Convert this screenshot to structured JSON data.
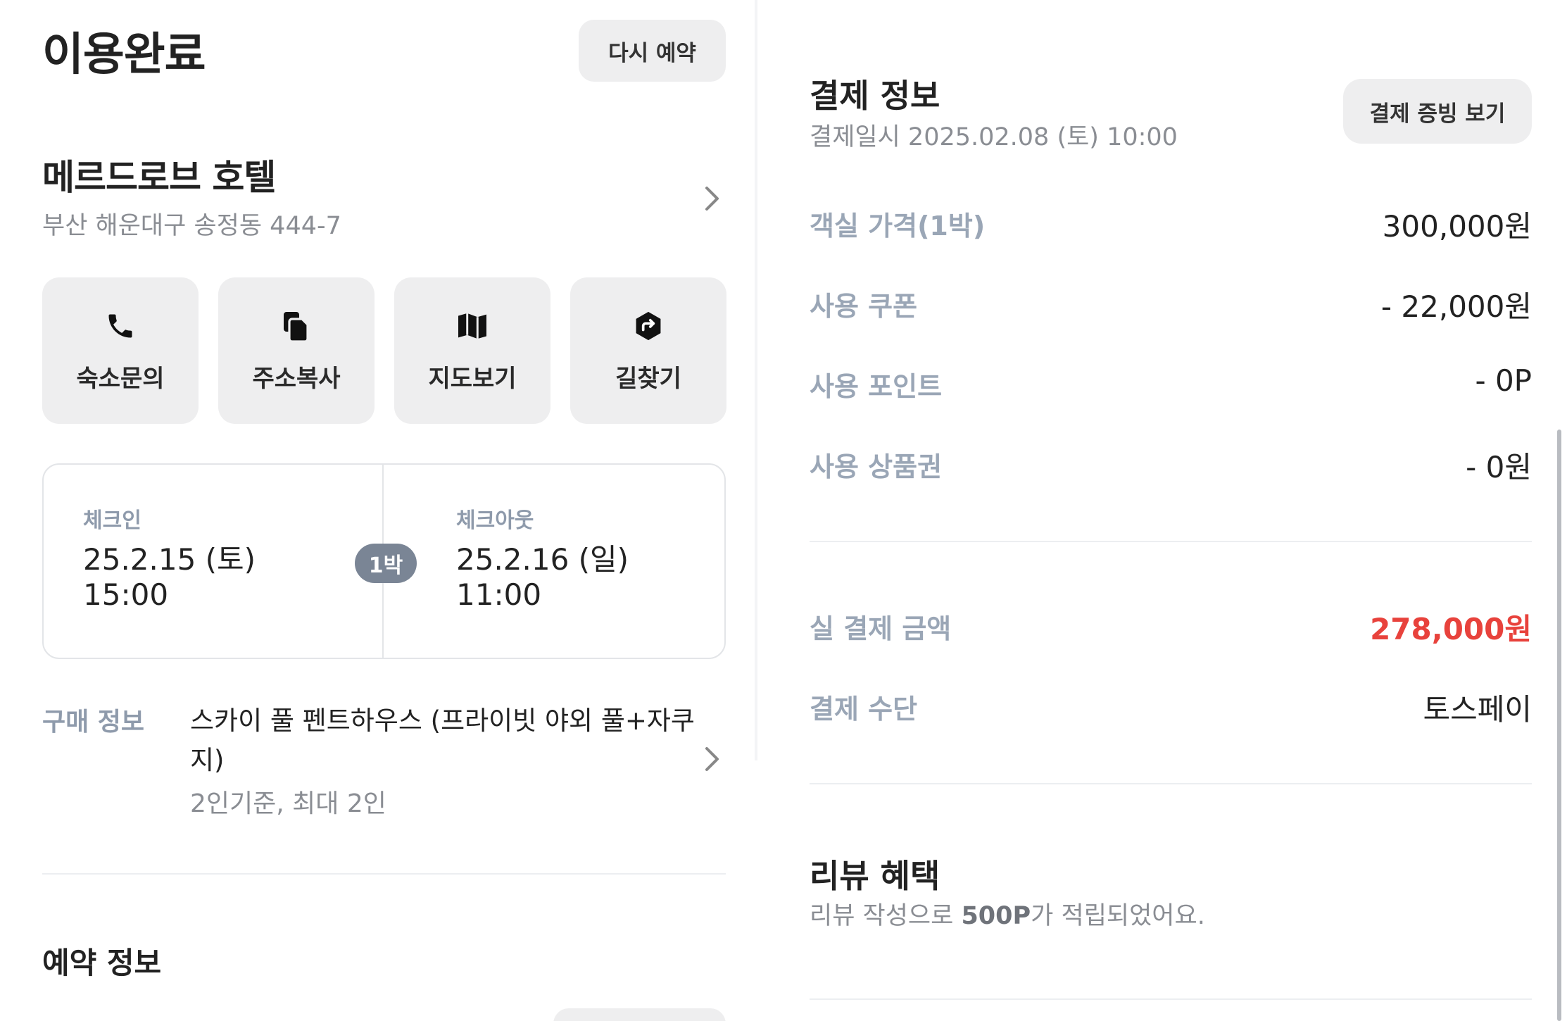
{
  "status": {
    "title": "이용완료",
    "rebook_label": "다시 예약"
  },
  "hotel": {
    "name": "메르드로브 호텔",
    "address": "부산 해운대구 송정동 444-7"
  },
  "actions": [
    {
      "label": "숙소문의",
      "icon": "phone-icon"
    },
    {
      "label": "주소복사",
      "icon": "copy-icon"
    },
    {
      "label": "지도보기",
      "icon": "map-icon"
    },
    {
      "label": "길찾기",
      "icon": "directions-icon"
    }
  ],
  "stay": {
    "checkin_label": "체크인",
    "checkin_date": "25.2.15 (토)",
    "checkin_time": "15:00",
    "nights": "1박",
    "checkout_label": "체크아웃",
    "checkout_date": "25.2.16 (일)",
    "checkout_time": "11:00"
  },
  "purchase": {
    "label": "구매 정보",
    "product": "스카이 풀 펜트하우스 (프라이빗 야외 풀+자쿠지)",
    "capacity": "2인기준, 최대 2인"
  },
  "reservation": {
    "title": "예약 정보"
  },
  "payment": {
    "title": "결제 정보",
    "date": "결제일시 2025.02.08 (토) 10:00",
    "receipt_label": "결제 증빙 보기",
    "rows": [
      {
        "label": "객실 가격(1박)",
        "value": "300,000원"
      },
      {
        "label": "사용 쿠폰",
        "value": "- 22,000원"
      },
      {
        "label": "사용 포인트",
        "value": "- 0P"
      },
      {
        "label": "사용 상품권",
        "value": "- 0원"
      }
    ],
    "total_label": "실 결제 금액",
    "total_value": "278,000원",
    "method_label": "결제 수단",
    "method_value": "토스페이",
    "accent_color": "#e8423c"
  },
  "review": {
    "title": "리뷰 혜택",
    "desc_prefix": "리뷰 작성으로 ",
    "desc_points": "500P",
    "desc_suffix": "가 적립되었어요."
  }
}
